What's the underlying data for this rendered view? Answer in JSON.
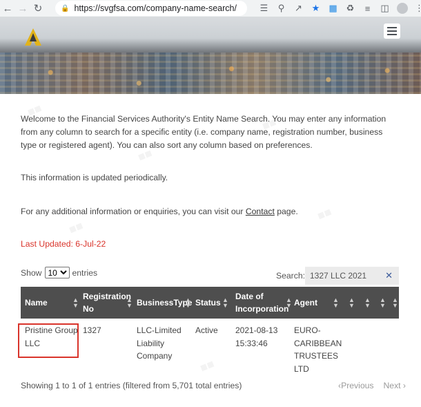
{
  "browser": {
    "url": "https://svgfsa.com/company-name-search/",
    "back_icon": "arrow-left-icon",
    "forward_icon": "arrow-right-icon",
    "reload_icon": "reload-icon"
  },
  "banner": {
    "menu_icon": "hamburger-menu-icon"
  },
  "intro": {
    "paragraph": "Welcome to the Financial Services Authority's Entity Name Search. You may enter any information from any column to search for a specific entity (i.e. company name, registration number, business type or registered agent). You can also sort any column based on preferences.",
    "updated_note": "This information is updated periodically.",
    "contact_prefix": "For any additional information or enquiries, you can visit our ",
    "contact_link": "Contact",
    "contact_suffix": " page."
  },
  "last_updated": {
    "label": "Last Updated: ",
    "date": "6-Jul-22",
    "color": "#d9342b"
  },
  "controls": {
    "show_label": "Show",
    "entries_label": "entries",
    "page_size": "10",
    "search_label": "Search:",
    "search_value": "1327 LLC 2021"
  },
  "table": {
    "headers": {
      "name": "Name",
      "registration_line1": "Registration",
      "registration_line2": "No",
      "business_type": "BusinessType",
      "status": "Status",
      "date_line1": "Date of",
      "date_line2": "Incorporation",
      "agent": "Agent"
    },
    "rows": [
      {
        "name_line1": "Pristine Group",
        "name_line2": "LLC",
        "registration": "1327",
        "type_line1": "LLC-Limited",
        "type_line2": "Liability",
        "type_line3": "Company",
        "status": "Active",
        "date_line1": "2021-08-13",
        "date_line2": "15:33:46",
        "agent_line1": "EURO-",
        "agent_line2": "CARIBBEAN",
        "agent_line3": "TRUSTEES",
        "agent_line4": "LTD"
      }
    ]
  },
  "footer": {
    "info": "Showing 1 to 1 of 1 entries (filtered from 5,701 total entries)",
    "previous": "Previous",
    "next": "Next"
  },
  "colors": {
    "header_bg": "#4e4e4e",
    "highlight": "#d9342b",
    "link": "#333333"
  }
}
